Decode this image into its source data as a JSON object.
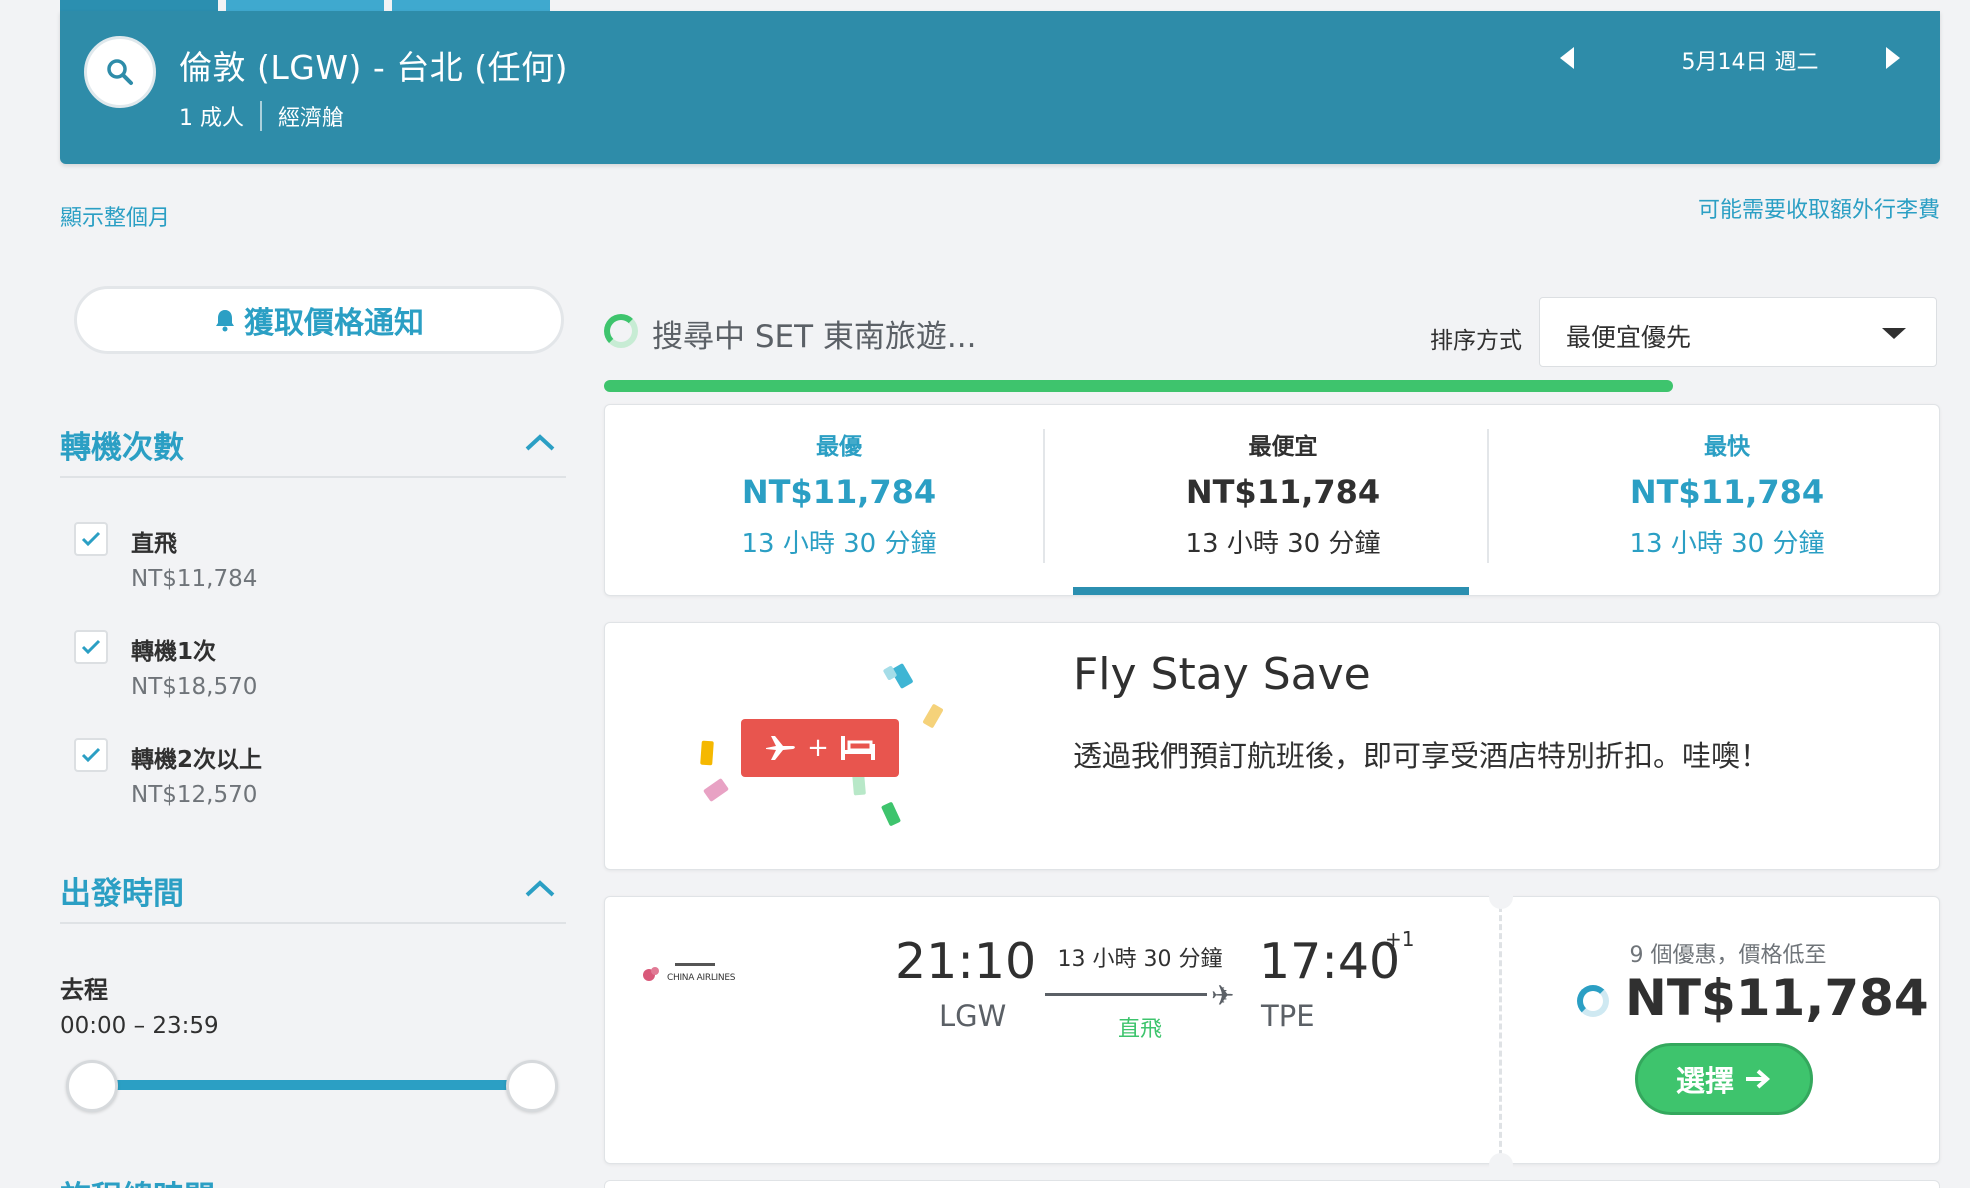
{
  "colors": {
    "header": "#2e8ca9",
    "accent": "#2b9fc4",
    "green": "#3ec46d",
    "promo_red": "#e8554e"
  },
  "header": {
    "route": "倫敦 (LGW) - 台北 (任何)",
    "passengers": "1 成人",
    "cabin": "經濟艙",
    "date": "5月14日 週二"
  },
  "links": {
    "show_month": "顯示整個月",
    "baggage_note": "可能需要收取額外行李費"
  },
  "sidebar": {
    "price_alert": "獲取價格通知",
    "stops": {
      "title": "轉機次數",
      "options": [
        {
          "label": "直飛",
          "price": "NT$11,784",
          "checked": true
        },
        {
          "label": "轉機1次",
          "price": "NT$18,570",
          "checked": true
        },
        {
          "label": "轉機2次以上",
          "price": "NT$12,570",
          "checked": true
        }
      ]
    },
    "departure": {
      "title": "出發時間",
      "leg_label": "去程",
      "range": "00:00 – 23:59",
      "slider_min": 0,
      "slider_max": 1
    },
    "next_section": "旅程總時間"
  },
  "search_status": {
    "text": "搜尋中 SET 東南旅遊...",
    "progress": 0.8
  },
  "sort": {
    "label": "排序方式",
    "value": "最便宜優先"
  },
  "summary_tabs": [
    {
      "label": "最優",
      "price": "NT$11,784",
      "duration": "13 小時 30 分鐘"
    },
    {
      "label": "最便宜",
      "price": "NT$11,784",
      "duration": "13 小時 30 分鐘",
      "active": true
    },
    {
      "label": "最快",
      "price": "NT$11,784",
      "duration": "13 小時 30 分鐘"
    }
  ],
  "promo": {
    "title": "Fly Stay Save",
    "subtitle": "透過我們預訂航班後，即可享受酒店特別折扣。哇噢！",
    "badge_plus": "+"
  },
  "flight": {
    "airline_logo_text": "CHINA AIRLINES",
    "depart_time": "21:10",
    "depart_airport": "LGW",
    "duration": "13 小時 30 分鐘",
    "stops": "直飛",
    "arrive_time": "17:40",
    "day_offset": "+1",
    "arrive_airport": "TPE",
    "deals": "9 個優惠，價格低至",
    "price": "NT$11,784",
    "select_label": "選擇"
  }
}
